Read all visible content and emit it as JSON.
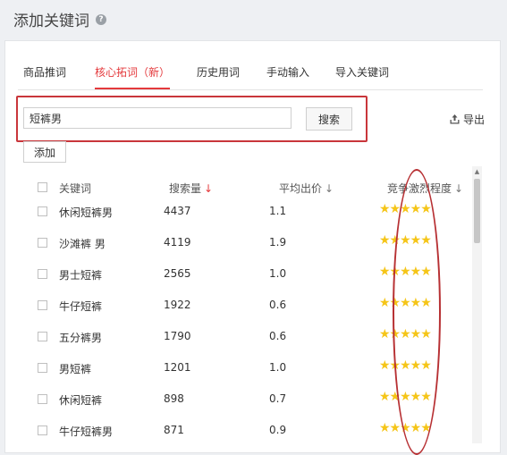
{
  "page_title": "添加关键词",
  "help_icon": "question-circle-icon",
  "tabs": [
    {
      "label": "商品推词",
      "active": false
    },
    {
      "label": "核心拓词（新）",
      "active": true
    },
    {
      "label": "历史用词",
      "active": false
    },
    {
      "label": "手动输入",
      "active": false
    },
    {
      "label": "导入关键词",
      "active": false
    }
  ],
  "search": {
    "value": "短裤男",
    "button_label": "搜索"
  },
  "export_label": "导出",
  "add_label": "添加",
  "table": {
    "headers": {
      "keyword": "关键词",
      "search_volume": "搜索量",
      "avg_bid": "平均出价",
      "competition": "竞争激烈程度"
    },
    "sort_arrow": "↓",
    "rows": [
      {
        "keyword": "休闲短裤男",
        "search_volume": "4437",
        "avg_bid": "1.1",
        "stars": 5
      },
      {
        "keyword": "沙滩裤 男",
        "search_volume": "4119",
        "avg_bid": "1.9",
        "stars": 5
      },
      {
        "keyword": "男士短裤",
        "search_volume": "2565",
        "avg_bid": "1.0",
        "stars": 5
      },
      {
        "keyword": "牛仔短裤",
        "search_volume": "1922",
        "avg_bid": "0.6",
        "stars": 5
      },
      {
        "keyword": "五分裤男",
        "search_volume": "1790",
        "avg_bid": "0.6",
        "stars": 5
      },
      {
        "keyword": "男短裤",
        "search_volume": "1201",
        "avg_bid": "1.0",
        "stars": 5
      },
      {
        "keyword": "休闲短裤",
        "search_volume": "898",
        "avg_bid": "0.7",
        "stars": 5
      },
      {
        "keyword": "牛仔短裤男",
        "search_volume": "871",
        "avg_bid": "0.9",
        "stars": 5
      }
    ]
  },
  "colors": {
    "accent": "#e4393c",
    "annotation": "#c9363b",
    "star": "#f5c518"
  }
}
